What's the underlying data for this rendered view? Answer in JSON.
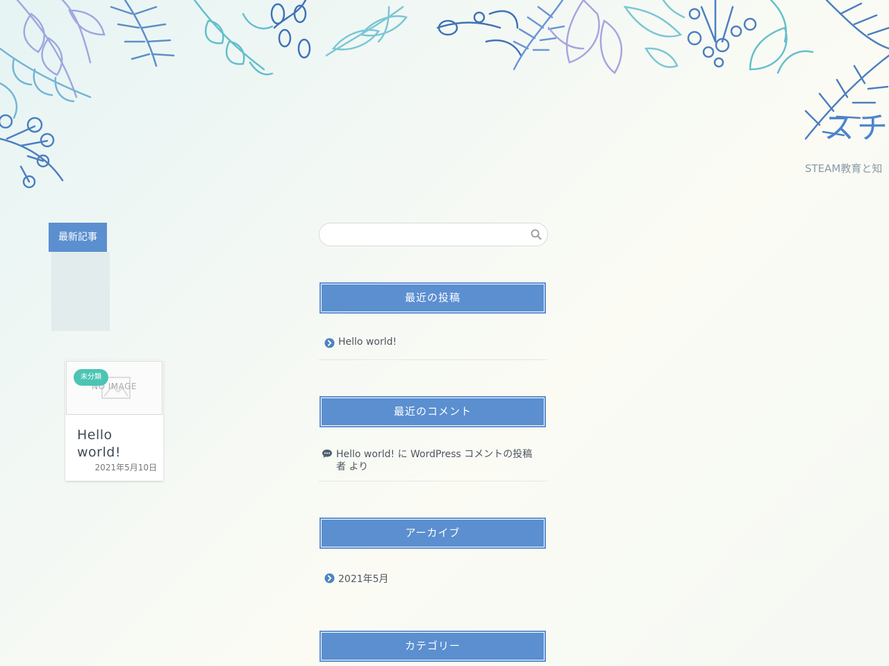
{
  "site": {
    "title": "スチ",
    "tagline": "STEAM教育と知"
  },
  "latest": {
    "label": "最新記事",
    "posts": [
      {
        "category": "未分類",
        "thumbnail_text": "NO IMAGE",
        "title": "Hello world!",
        "date": "2021年5月10日"
      }
    ]
  },
  "search": {
    "value": "",
    "placeholder": ""
  },
  "widgets": {
    "recent_posts": {
      "title": "最近の投稿",
      "items": [
        "Hello world!"
      ]
    },
    "recent_comments": {
      "title": "最近のコメント",
      "items": [
        {
          "post": "Hello world!",
          "connector": "に",
          "author": "WordPress コメントの投稿者",
          "suffix": "より"
        }
      ]
    },
    "archives": {
      "title": "アーカイブ",
      "items": [
        "2021年5月"
      ]
    },
    "categories": {
      "title": "カテゴリー"
    }
  },
  "colors": {
    "accent": "#5b8fd0",
    "badge": "#4cc4b4",
    "title_blue": "#4b84cf"
  },
  "icons": {
    "search": "search-icon",
    "post_bullet": "chevron-circle-right-icon",
    "comment_bullet": "comment-icon"
  }
}
